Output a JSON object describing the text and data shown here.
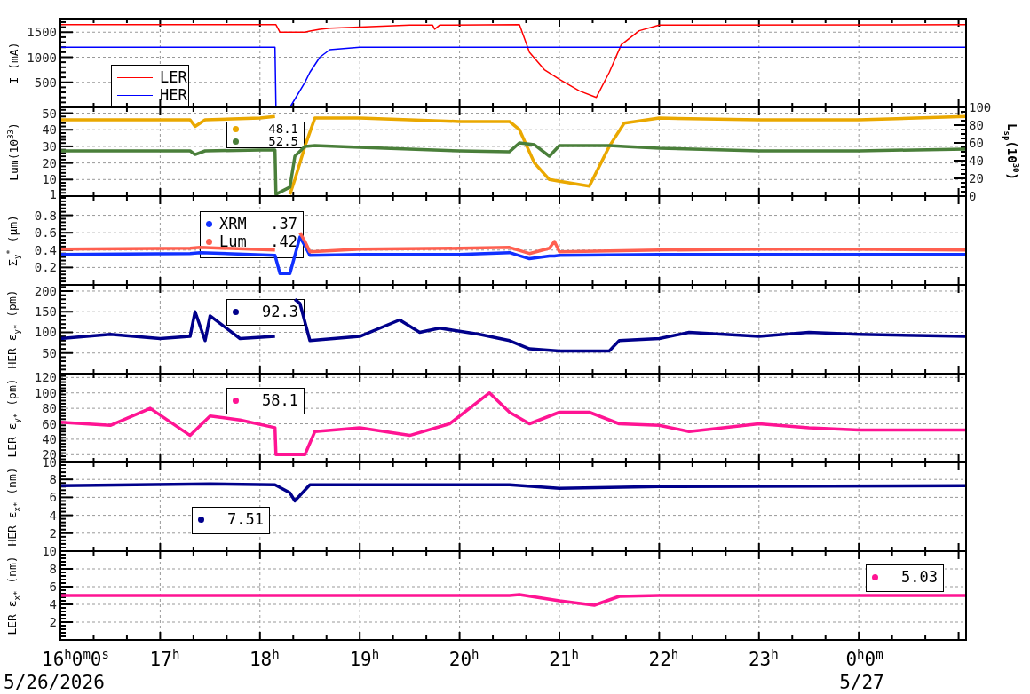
{
  "panels": [
    {
      "chart_data": {
        "type": "line",
        "ylabel": "I (mA)",
        "grid": true,
        "legend": {
          "kind": "lines"
        },
        "x": [
          16,
          18.15,
          18.16,
          18.2,
          18.3,
          18.45,
          18.5,
          18.6,
          18.7,
          19.0,
          19.5,
          19.73,
          19.75,
          19.8,
          20.6,
          20.7,
          20.85,
          21.0,
          21.2,
          21.37,
          21.5,
          21.62,
          21.8,
          22.0,
          25.07
        ],
        "xlim": [
          16,
          25.075
        ],
        "ylim": [
          0,
          1770
        ],
        "yticks": [
          500,
          1000,
          1500
        ],
        "series": [
          {
            "name": "LER",
            "color": "#ff0000",
            "values": [
              1650,
              1650,
              1650,
              1500,
              1500,
              1500,
              1520,
              1560,
              1580,
              1600,
              1640,
              1640,
              1560,
              1640,
              1650,
              1100,
              750,
              560,
              330,
              200,
              700,
              1250,
              1530,
              1640,
              1650
            ]
          },
          {
            "name": "HER",
            "color": "#0000ff",
            "values": [
              1200,
              1200,
              0,
              0,
              0,
              500,
              700,
              1000,
              1150,
              1200,
              1200,
              1200,
              1200,
              1200,
              1200,
              1200,
              1200,
              1200,
              1200,
              1200,
              1200,
              1200,
              1200,
              1200,
              1200
            ]
          }
        ]
      }
    },
    {
      "y2_label": "L$_{sp}$(10$^{30}$)",
      "readout": {
        "values": [
          "48.1",
          "52.5"
        ]
      },
      "chart_data": {
        "type": "line",
        "ylabel": "Lum(10$^{33}$)",
        "grid": true,
        "x": [
          16,
          17.3,
          17.35,
          17.45,
          18.0,
          18.15,
          18.16,
          18.3,
          18.35,
          18.45,
          18.55,
          19.0,
          20.0,
          20.5,
          20.6,
          20.75,
          20.9,
          21.0,
          21.3,
          21.5,
          21.65,
          22.0,
          23.0,
          24.0,
          25.07
        ],
        "xlim": [
          16,
          25.075
        ],
        "ylim": [
          0,
          53.5
        ],
        "y2lim": [
          0,
          100
        ],
        "yticks": [
          1,
          10,
          20,
          30,
          40,
          50
        ],
        "y2ticks": [
          0,
          20,
          40,
          60,
          80,
          100
        ],
        "series": [
          {
            "color": "#eaa800",
            "values": [
              46,
              46,
              42,
              46,
              47,
              48,
              null,
              1,
              10,
              30,
              47,
              47,
              45,
              45,
              40,
              20,
              10,
              9,
              6,
              30,
              44,
              47,
              46,
              46,
              48
            ]
          },
          {
            "color": "#4a7f3a",
            "values": [
              27.3,
              27.3,
              25.1,
              27.3,
              27.8,
              27.8,
              1.1,
              5.4,
              24.1,
              30,
              30.5,
              29.4,
              27.3,
              26.8,
              32.1,
              31,
              24.1,
              30.5,
              30.5,
              30.5,
              30,
              28.9,
              27.3,
              27.3,
              28.4
            ]
          }
        ]
      }
    },
    {
      "chart_data": {
        "type": "line",
        "ylabel": "Σ$_{y}$$^{*}$ (μm)",
        "grid": true,
        "legend": {
          "kind": "dots",
          "values": [
            ".37",
            ".42"
          ]
        },
        "x": [
          16,
          17.3,
          17.4,
          18.15,
          18.2,
          18.3,
          18.4,
          18.45,
          18.5,
          19.0,
          20.0,
          20.5,
          20.7,
          20.9,
          20.95,
          21.0,
          22.0,
          23.0,
          24.0,
          25.07
        ],
        "xlim": [
          16,
          25.075
        ],
        "ylim": [
          0,
          1.02
        ],
        "yticks": [
          0.2,
          0.4,
          0.6,
          0.8
        ],
        "series": [
          {
            "name": "XRM",
            "color": "#1030ff",
            "values": [
              0.35,
              0.36,
              0.37,
              0.34,
              0.13,
              0.13,
              0.55,
              0.45,
              0.34,
              0.35,
              0.35,
              0.37,
              0.3,
              0.33,
              0.33,
              0.34,
              0.35,
              0.35,
              0.35,
              0.35
            ]
          },
          {
            "name": "Lum",
            "color": "#ff6050",
            "values": [
              0.41,
              0.42,
              0.43,
              0.4,
              null,
              null,
              0.6,
              0.5,
              0.38,
              0.41,
              0.42,
              0.43,
              0.36,
              0.42,
              0.5,
              0.38,
              0.4,
              0.41,
              0.41,
              0.4
            ]
          }
        ]
      }
    },
    {
      "readout": {
        "values": [
          "92.3"
        ]
      },
      "chart_data": {
        "type": "line",
        "ylabel": "HER ε$_{y*}$ (pm)",
        "grid": true,
        "x": [
          16,
          16.5,
          17.0,
          17.3,
          17.35,
          17.45,
          17.5,
          17.8,
          18.15,
          18.2,
          18.35,
          18.4,
          18.5,
          19.0,
          19.4,
          19.6,
          19.8,
          20.2,
          20.5,
          20.7,
          21.0,
          21.5,
          21.6,
          22.0,
          22.3,
          23.0,
          23.5,
          24.0,
          25.07
        ],
        "xlim": [
          16,
          25.075
        ],
        "ylim": [
          0,
          215
        ],
        "yticks": [
          50,
          100,
          150,
          200
        ],
        "series": [
          {
            "color": "#00008b",
            "values": [
              85,
              95,
              85,
              90,
              150,
              80,
              140,
              85,
              90,
              null,
              180,
              170,
              80,
              90,
              130,
              100,
              110,
              95,
              80,
              60,
              55,
              55,
              80,
              85,
              100,
              90,
              100,
              95,
              90
            ]
          }
        ]
      }
    },
    {
      "readout": {
        "values": [
          "58.1"
        ]
      },
      "chart_data": {
        "type": "line",
        "ylabel": "LER ε$_{y*}$ (pm)",
        "grid": true,
        "x": [
          16,
          16.5,
          16.9,
          17.3,
          17.5,
          17.8,
          18.15,
          18.16,
          18.45,
          18.55,
          19.0,
          19.5,
          19.9,
          20.3,
          20.5,
          20.7,
          21.0,
          21.3,
          21.6,
          22.0,
          22.3,
          23.0,
          23.5,
          24.0,
          25.07
        ],
        "xlim": [
          16,
          25.075
        ],
        "ylim": [
          10,
          125
        ],
        "yticks": [
          10,
          20,
          40,
          60,
          80,
          100,
          120
        ],
        "series": [
          {
            "color": "#ff1493",
            "values": [
              62,
              58,
              80,
              45,
              70,
              65,
              55,
              20,
              20,
              50,
              55,
              45,
              60,
              100,
              75,
              60,
              75,
              75,
              60,
              58,
              50,
              60,
              55,
              52,
              52
            ]
          }
        ]
      }
    },
    {
      "readout": {
        "values": [
          "7.51"
        ]
      },
      "chart_data": {
        "type": "line",
        "ylabel": "HER ε$_{x*}$ (nm)",
        "grid": true,
        "x": [
          16,
          17.5,
          18.15,
          18.3,
          18.35,
          18.5,
          19.0,
          20.5,
          21.0,
          22.0,
          25.07
        ],
        "xlim": [
          16,
          25.075
        ],
        "ylim": [
          0,
          9.9
        ],
        "yticks": [
          2,
          4,
          6,
          8
        ],
        "series": [
          {
            "color": "#00008b",
            "values": [
              7.3,
              7.5,
              7.4,
              6.5,
              5.6,
              7.4,
              7.4,
              7.4,
              7.0,
              7.2,
              7.3
            ]
          }
        ]
      }
    },
    {
      "readout": {
        "values": [
          "5.03"
        ]
      },
      "chart_data": {
        "type": "line",
        "ylabel": "LER ε$_{x*}$ (nm)",
        "grid": true,
        "x": [
          16,
          20.5,
          20.6,
          21.0,
          21.35,
          21.6,
          22.0,
          25.07
        ],
        "xlim": [
          16,
          25.075
        ],
        "ylim": [
          0,
          10
        ],
        "yticks": [
          2,
          4,
          6,
          8,
          10
        ],
        "xticks": [
          {
            "value": 16,
            "label": "16$^{h}$0$^{m}$0$^{s}$"
          },
          {
            "value": 17,
            "label": "17$^{h}$"
          },
          {
            "value": 18,
            "label": "18$^{h}$"
          },
          {
            "value": 19,
            "label": "19$^{h}$"
          },
          {
            "value": 20,
            "label": "20$^{h}$"
          },
          {
            "value": 21,
            "label": "21$^{h}$"
          },
          {
            "value": 22,
            "label": "22$^{h}$"
          },
          {
            "value": 23,
            "label": "23$^{h}$"
          },
          {
            "value": 24,
            "label": "0$^{h}$0$^{m}$"
          }
        ],
        "series": [
          {
            "color": "#ff1493",
            "values": [
              5.0,
              5.0,
              5.1,
              4.4,
              3.9,
              4.9,
              5.0,
              5.0
            ]
          }
        ]
      }
    }
  ],
  "date_labels": [
    "5/26/2026",
    "5/27"
  ]
}
